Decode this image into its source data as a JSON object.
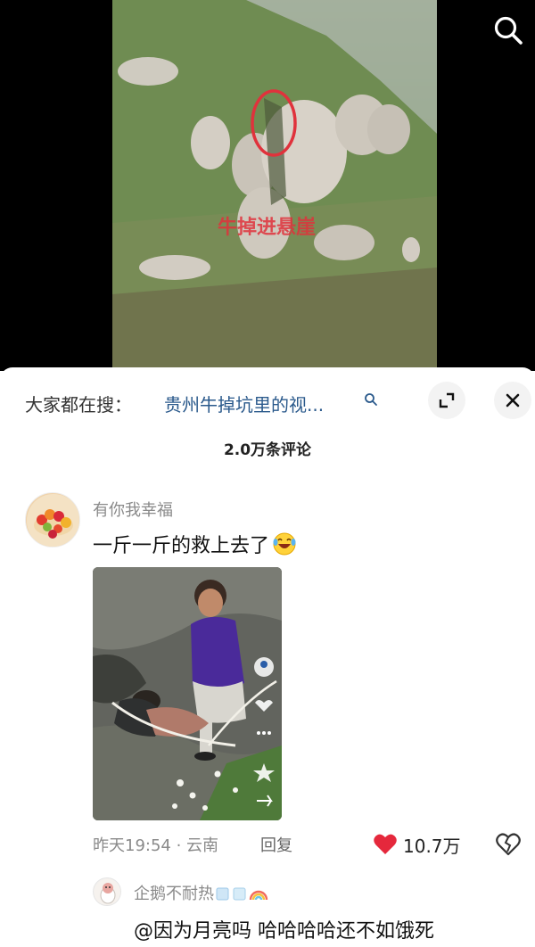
{
  "video": {
    "caption": "牛掉进悬崖"
  },
  "sheet": {
    "search": {
      "prefix": "大家都在搜：",
      "query": "贵州牛掉坑里的视..."
    },
    "comment_count": "2.0万条评论",
    "comments": [
      {
        "username": "有你我幸福",
        "text": "一斤一斤的救上去了",
        "time_location": "昨天19:54 · 云南",
        "reply_label": "回复",
        "likes": "10.7万",
        "liked": true
      }
    ],
    "reply": {
      "username": "企鹅不耐热",
      "text": "@因为月亮吗 哈哈哈哈还不如饿死"
    }
  },
  "colors": {
    "like_red": "#e5283c",
    "link_blue": "#2b5a8c",
    "mark_red": "#e0323c"
  },
  "icons": [
    "search-icon",
    "expand-icon",
    "close-icon",
    "heart-icon",
    "broken-heart-icon",
    "laugh-emoji-icon"
  ]
}
